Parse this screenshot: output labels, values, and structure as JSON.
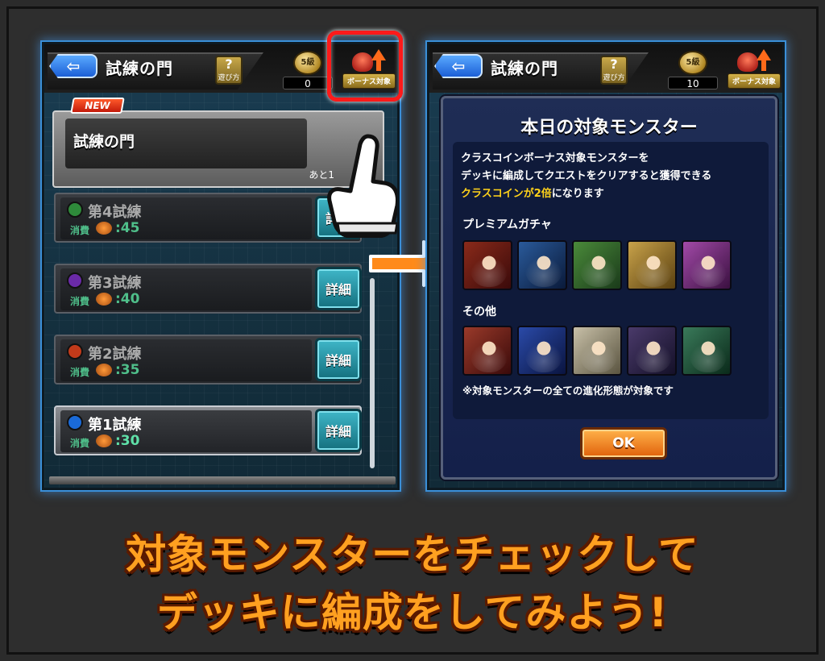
{
  "left_screen": {
    "title": "試練の門",
    "howto_label": "遊び方",
    "howto_icon": "?",
    "coin_label": "5級",
    "coin_count": "0",
    "bonus_label": "ボーナス対象",
    "new_badge": "NEW",
    "gate_name": "試練の門",
    "gate_remaining": "あと1",
    "trials": [
      {
        "name": "第4試練",
        "cost_label": "消費",
        "cost_value": ":45",
        "detail": "詳細",
        "orb_color": "#2e8a3a"
      },
      {
        "name": "第3試練",
        "cost_label": "消費",
        "cost_value": ":40",
        "detail": "詳細",
        "orb_color": "#6a2aa8"
      },
      {
        "name": "第2試練",
        "cost_label": "消費",
        "cost_value": ":35",
        "detail": "詳細",
        "orb_color": "#c23a1a"
      },
      {
        "name": "第1試練",
        "cost_label": "消費",
        "cost_value": ":30",
        "detail": "詳細",
        "orb_color": "#1a6ad8"
      }
    ]
  },
  "right_screen": {
    "title": "試練の門",
    "howto_label": "遊び方",
    "howto_icon": "?",
    "coin_label": "5級",
    "coin_count": "10",
    "bonus_label": "ボーナス対象",
    "modal": {
      "title": "本日の対象モンスター",
      "desc_line1": "クラスコインボーナス対象モンスターを",
      "desc_line2": "デッキに編成してクエストをクリアすると獲得できる",
      "desc_highlight": "クラスコインが2倍",
      "desc_line3_rest": "になります",
      "premium_label": "プレミアムガチャ",
      "premium_monsters": [
        "#8a2a1a",
        "#2a5a9a",
        "#4a8a3a",
        "#c8a24a",
        "#a24aa8"
      ],
      "other_label": "その他",
      "other_monsters": [
        "#9a3a2a",
        "#2a4aa8",
        "#c8c0a8",
        "#4a3a6a",
        "#3a7a5a"
      ],
      "note": "※対象モンスターの全ての進化形態が対象です",
      "ok_label": "OK"
    }
  },
  "caption": {
    "line1": "対象モンスターをチェックして",
    "line2": "デッキに編成をしてみよう!"
  }
}
